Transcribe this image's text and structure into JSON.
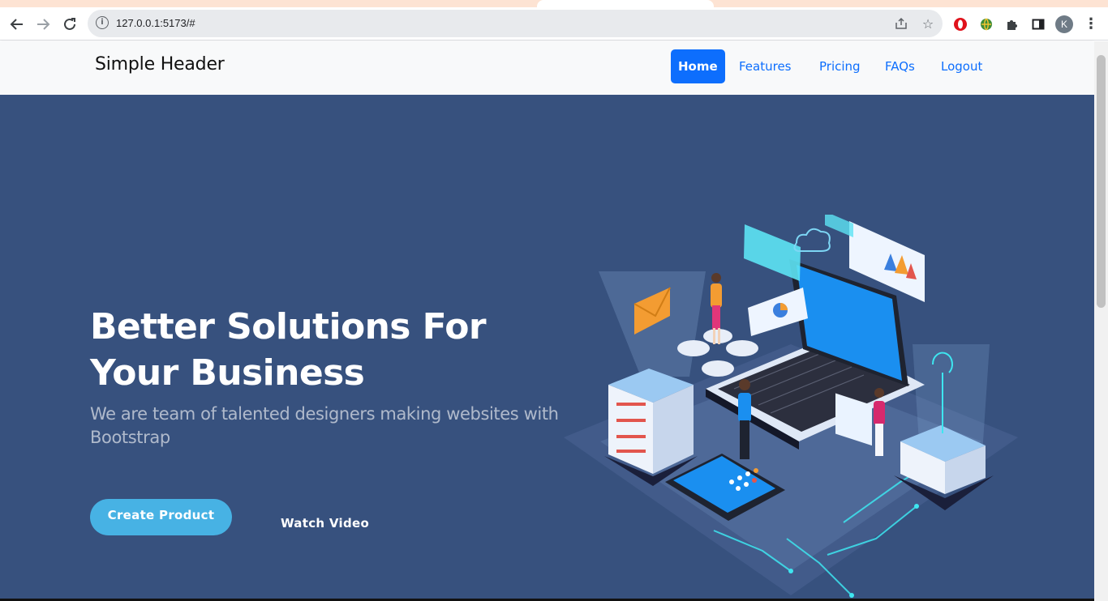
{
  "browser": {
    "url": "127.0.0.1:5173/#",
    "profile_initial": "K",
    "icons": [
      "back-icon",
      "forward-icon",
      "reload-icon",
      "info-icon",
      "share-icon",
      "star-icon",
      "opera-extension-icon",
      "globe-extension-icon",
      "puzzle-icon",
      "sidepanel-icon",
      "kebab-menu-icon"
    ]
  },
  "header": {
    "brand": "Simple Header",
    "nav": [
      {
        "label": "Home",
        "active": true
      },
      {
        "label": "Features",
        "active": false
      },
      {
        "label": "Pricing",
        "active": false
      },
      {
        "label": "FAQs",
        "active": false
      },
      {
        "label": "Logout",
        "active": false
      }
    ]
  },
  "hero": {
    "title": "Better Solutions For Your Business",
    "subtitle": "We are team of talented designers making websites with Bootstrap",
    "primary_button": "Create Product",
    "secondary_button": "Watch Video",
    "illustration": "isometric-laptop-server-illustration"
  },
  "colors": {
    "hero_bg": "#37517e",
    "accent": "#47b2e4",
    "nav_active": "#0d6efd",
    "header_bg": "#f8f9fa"
  }
}
